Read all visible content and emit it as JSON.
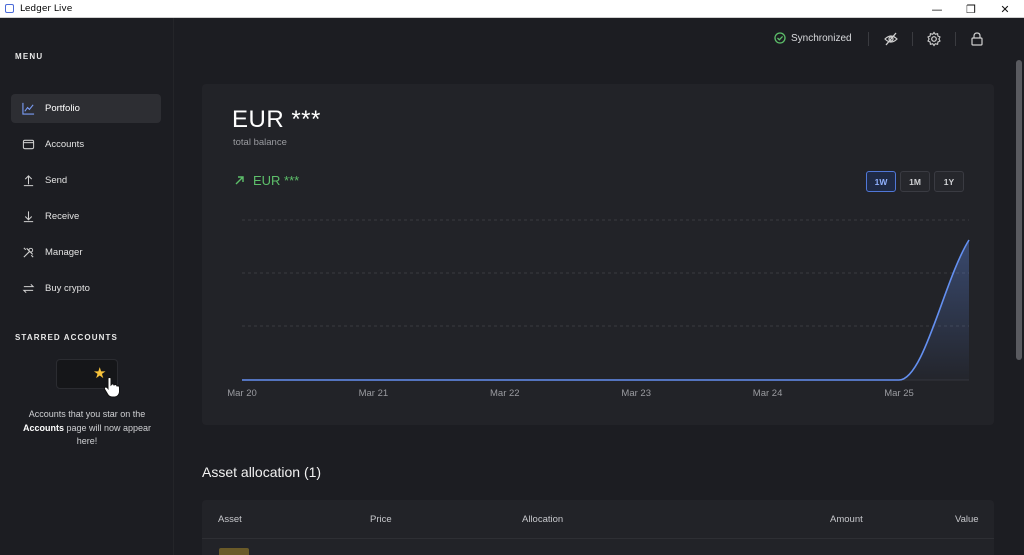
{
  "window": {
    "title": "Ledger Live",
    "controls": [
      "minimize",
      "restore",
      "close"
    ]
  },
  "sidebar": {
    "menu_title": "MENU",
    "items": [
      {
        "label": "Portfolio",
        "icon": "chart-line-icon",
        "active": true
      },
      {
        "label": "Accounts",
        "icon": "wallet-icon",
        "active": false
      },
      {
        "label": "Send",
        "icon": "arrow-up-icon",
        "active": false
      },
      {
        "label": "Receive",
        "icon": "arrow-down-icon",
        "active": false
      },
      {
        "label": "Manager",
        "icon": "tools-icon",
        "active": false
      },
      {
        "label": "Buy crypto",
        "icon": "swap-icon",
        "active": false
      }
    ],
    "starred_title": "STARRED ACCOUNTS",
    "starred_text_1": "Accounts that you star on the",
    "starred_text_bold": "Accounts",
    "starred_text_2": "page will now appear here!"
  },
  "topbar": {
    "sync_status": "Synchronized",
    "icons": [
      "eye-slash-icon",
      "gear-icon",
      "lock-icon"
    ]
  },
  "portfolio": {
    "balance": "EUR ***",
    "balance_label": "total balance",
    "delta": "EUR ***",
    "ranges": [
      {
        "label": "1W",
        "active": true
      },
      {
        "label": "1M",
        "active": false
      },
      {
        "label": "1Y",
        "active": false
      }
    ]
  },
  "chart_data": {
    "type": "area",
    "x": [
      "Mar 20",
      "Mar 21",
      "Mar 22",
      "Mar 23",
      "Mar 24",
      "Mar 25"
    ],
    "values": [
      0,
      0,
      0,
      0,
      0,
      0,
      1
    ],
    "xlabel": "",
    "ylabel": "",
    "grid": true,
    "color": "#6490f1"
  },
  "assets": {
    "title": "Asset allocation (1)",
    "columns": [
      "Asset",
      "Price",
      "Allocation",
      "Amount",
      "Value"
    ]
  }
}
